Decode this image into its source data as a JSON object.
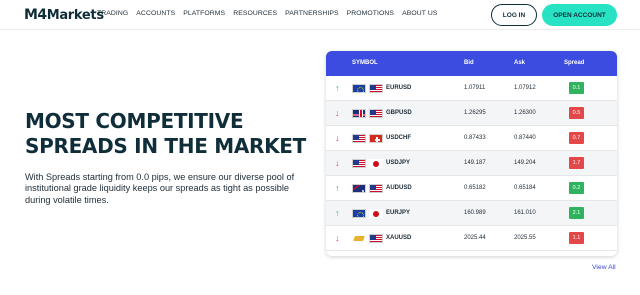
{
  "header": {
    "logo_mark": "M4",
    "logo_text": "Markets",
    "nav": [
      "TRADING",
      "ACCOUNTS",
      "PLATFORMS",
      "RESOURCES",
      "PARTNERSHIPS",
      "PROMOTIONS",
      "ABOUT US"
    ],
    "login_label": "LOG IN",
    "open_account_label": "OPEN ACCOUNT"
  },
  "hero": {
    "headline_line1": "MOST COMPETITIVE",
    "headline_line2": "SPREADS IN THE MARKET",
    "description": "With Spreads starting from 0.0 pips, we ensure our diverse pool of institutional grade liquidity keeps our spreads as tight as possible during volatile times."
  },
  "table": {
    "columns": {
      "symbol": "SYMBOL",
      "bid": "Bid",
      "ask": "Ask",
      "spread": "Spread"
    },
    "rows": [
      {
        "direction": "up",
        "symbol": "EURUSD",
        "flags": [
          "eu-flag-icon",
          "us-flag-icon"
        ],
        "bid": "1.07911",
        "ask": "1.07912",
        "spread": "0.1"
      },
      {
        "direction": "down",
        "symbol": "GBPUSD",
        "flags": [
          "gb-flag-icon",
          "us-flag-icon"
        ],
        "bid": "1.26295",
        "ask": "1.26300",
        "spread": "0.5"
      },
      {
        "direction": "down",
        "symbol": "USDCHF",
        "flags": [
          "us-flag-icon",
          "ch-flag-icon"
        ],
        "bid": "0.87433",
        "ask": "0.87440",
        "spread": "0.7"
      },
      {
        "direction": "down",
        "symbol": "USDJPY",
        "flags": [
          "us-flag-icon",
          "jp-flag-icon"
        ],
        "bid": "149.187",
        "ask": "149.204",
        "spread": "1.7"
      },
      {
        "direction": "up",
        "symbol": "AUDUSD",
        "flags": [
          "au-flag-icon",
          "us-flag-icon"
        ],
        "bid": "0.65182",
        "ask": "0.65184",
        "spread": "0.2"
      },
      {
        "direction": "up",
        "symbol": "EURJPY",
        "flags": [
          "eu-flag-icon",
          "jp-flag-icon"
        ],
        "bid": "160.989",
        "ask": "161.010",
        "spread": "2.1"
      },
      {
        "direction": "down",
        "symbol": "XAUUSD",
        "flags": [
          "gold-bar-icon",
          "us-flag-icon"
        ],
        "bid": "2025.44",
        "ask": "2025.55",
        "spread": "1.1"
      }
    ],
    "view_all_label": "View All"
  },
  "colors": {
    "accent": "#3c4be0",
    "cta": "#28e2c4",
    "up": "#2fb35e",
    "down": "#e34848",
    "heading": "#0f2e3a"
  }
}
